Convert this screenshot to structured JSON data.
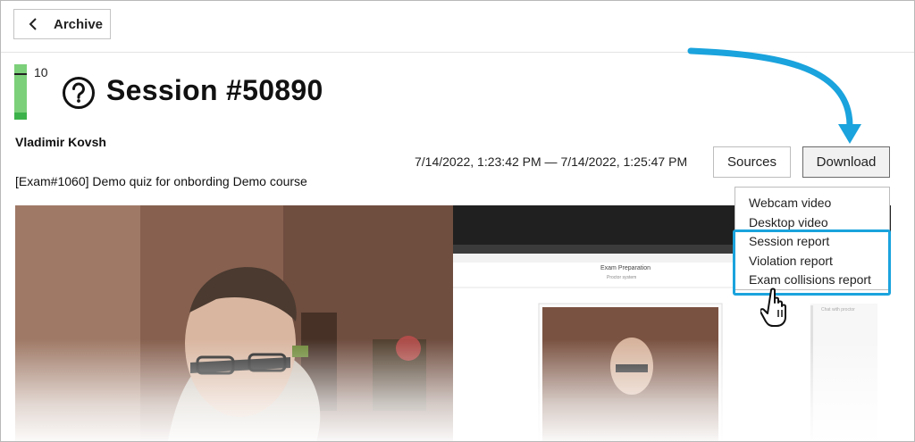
{
  "header": {
    "back_label": "Archive"
  },
  "session": {
    "score": "10",
    "title": "Session #50890",
    "user": "Vladimir Kovsh",
    "exam": "[Exam#1060] Demo quiz for onbording Demo course",
    "time_range": "7/14/2022, 1:23:42 PM — 7/14/2022, 1:25:47 PM"
  },
  "actions": {
    "sources_label": "Sources",
    "download_label": "Download"
  },
  "download_menu": {
    "items": [
      "Webcam video",
      "Desktop video",
      "Session report",
      "Violation report",
      "Exam collisions report"
    ]
  },
  "desktop_preview": {
    "page_title": "Exam Preparation",
    "page_subtitle": "Proctor system",
    "side_note": "Chat with proctor"
  },
  "colors": {
    "accent": "#1aa3dd",
    "score_bar": "#7cd07a",
    "score_bar_bottom": "#3cb34a"
  },
  "icons": {
    "back": "chevron-left-icon",
    "help": "question-circle-icon",
    "annotation_arrow": "arrow-icon",
    "pointer": "hand-pointer-icon"
  }
}
